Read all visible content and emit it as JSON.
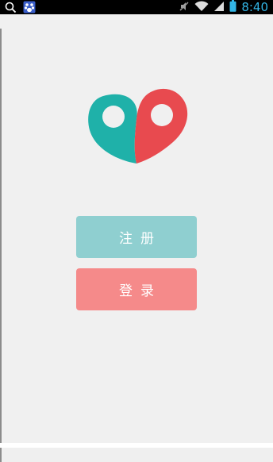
{
  "status_bar": {
    "time": "8:40",
    "icons": [
      "search-icon",
      "app-notification-icon",
      "mute-icon",
      "wifi-icon",
      "signal-icon",
      "battery-icon"
    ],
    "accent_color": "#33b5e5"
  },
  "logo": {
    "icon": "two-location-pins-heart-logo",
    "left_color": "#1fb1a9",
    "right_color": "#e84a4f"
  },
  "buttons": {
    "register_label": "注册",
    "login_label": "登录",
    "register_color": "#8fcfd0",
    "login_color": "#f58a8a"
  }
}
